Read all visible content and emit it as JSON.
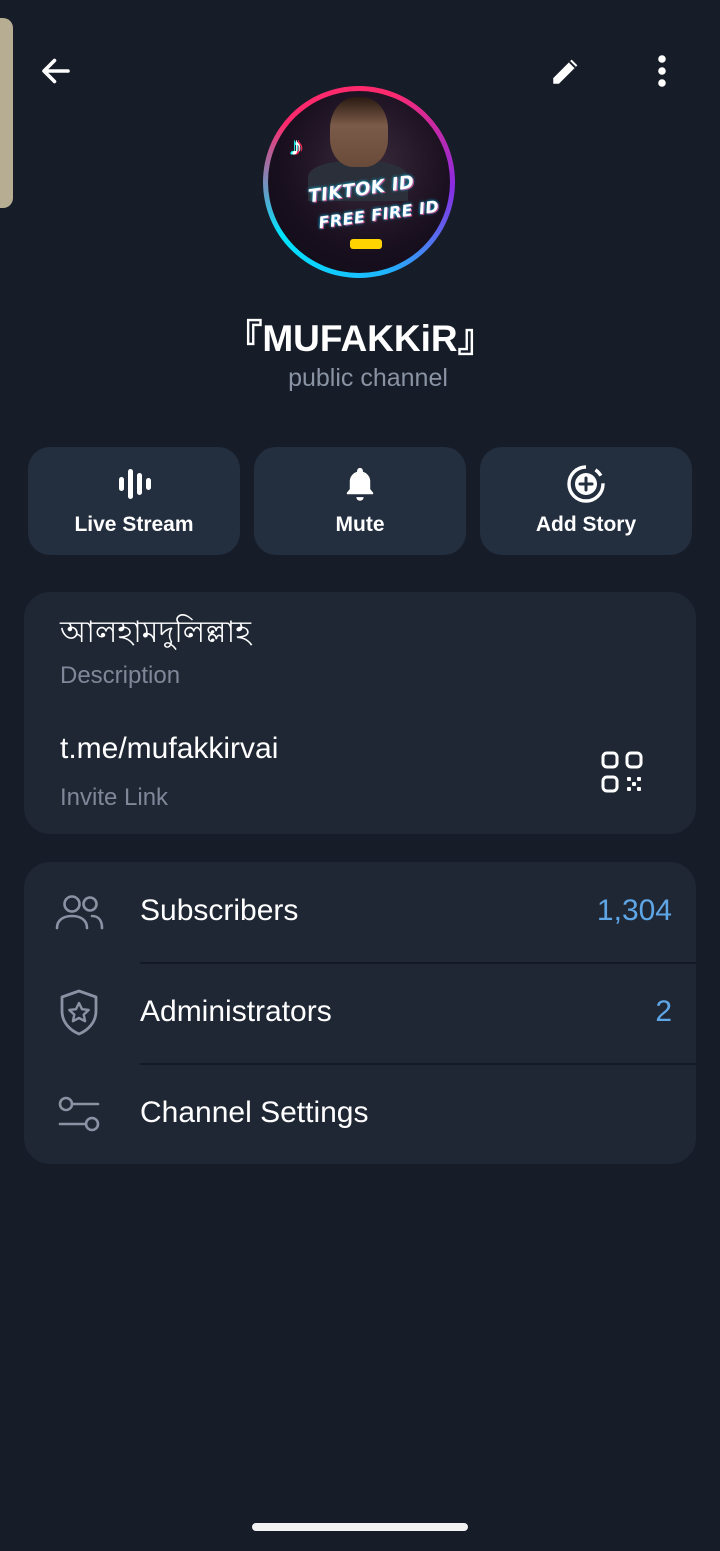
{
  "header": {
    "back_icon": "arrow-left-icon",
    "edit_icon": "pencil-icon",
    "more_icon": "more-vertical-icon"
  },
  "profile": {
    "name": "『MUFAKKiR』",
    "type": "public channel",
    "avatar_text_1": "TIKTOK ID",
    "avatar_text_2": "FREE FIRE ID"
  },
  "actions": [
    {
      "label": "Live Stream",
      "icon": "live-stream-icon"
    },
    {
      "label": "Mute",
      "icon": "bell-icon"
    },
    {
      "label": "Add Story",
      "icon": "add-story-icon"
    }
  ],
  "info": {
    "description_value": "আলহামদুলিল্লাহ",
    "description_label": "Description",
    "link_value": "t.me/mufakkirvai",
    "link_label": "Invite Link"
  },
  "list": [
    {
      "label": "Subscribers",
      "value": "1,304",
      "icon": "users-icon"
    },
    {
      "label": "Administrators",
      "value": "2",
      "icon": "shield-star-icon"
    },
    {
      "label": "Channel Settings",
      "value": "",
      "icon": "settings-sliders-icon"
    }
  ],
  "colors": {
    "background": "#161c28",
    "card": "#1f2735",
    "action_button": "#232e3e",
    "accent_value": "#5fa6e6",
    "secondary_text": "#7f8898"
  }
}
